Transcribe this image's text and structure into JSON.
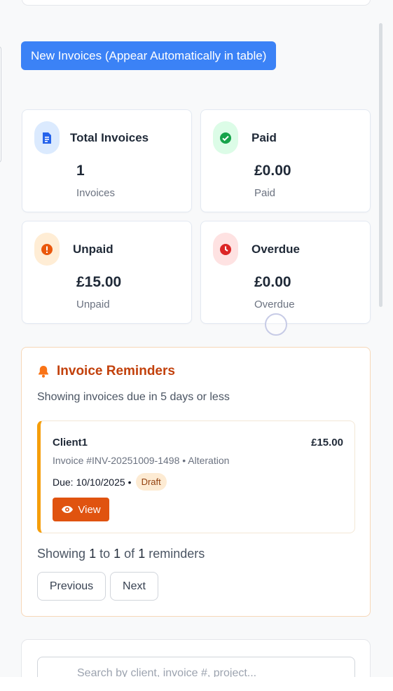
{
  "new_invoices_button": "New Invoices (Appear Automatically in table)",
  "stats": [
    {
      "title": "Total Invoices",
      "value": "1",
      "sub": "Invoices",
      "icon": "document-icon",
      "icon_bg": "#dbeafe",
      "icon_color": "#2563eb"
    },
    {
      "title": "Paid",
      "value": "£0.00",
      "sub": "Paid",
      "icon": "check-circle-icon",
      "icon_bg": "#dcfce7",
      "icon_color": "#16a34a"
    },
    {
      "title": "Unpaid",
      "value": "£15.00",
      "sub": "Unpaid",
      "icon": "exclamation-circle-icon",
      "icon_bg": "#ffedd5",
      "icon_color": "#ea580c"
    },
    {
      "title": "Overdue",
      "value": "£0.00",
      "sub": "Overdue",
      "icon": "clock-icon",
      "icon_bg": "#fee2e2",
      "icon_color": "#dc2626"
    }
  ],
  "reminders": {
    "title": "Invoice Reminders",
    "subtitle": "Showing invoices due in 5 days or less",
    "items": [
      {
        "client": "Client1",
        "amount": "£15.00",
        "invoice": "Invoice #INV-20251009-1498 • Alteration",
        "due_label": "Due:",
        "due_date": "10/10/2025",
        "separator": "•",
        "status": "Draft",
        "view_label": "View"
      }
    ],
    "showing": {
      "prefix": "Showing",
      "from": "1",
      "to_word": "to",
      "to": "1",
      "of_word": "of",
      "total": "1",
      "suffix": "reminders"
    },
    "prev_label": "Previous",
    "next_label": "Next"
  },
  "search": {
    "placeholder": "Search by client, invoice #, project..."
  },
  "colors": {
    "accent": "#3b82f6",
    "reminder_orange": "#c2410c",
    "view_button": "#e0530f"
  }
}
